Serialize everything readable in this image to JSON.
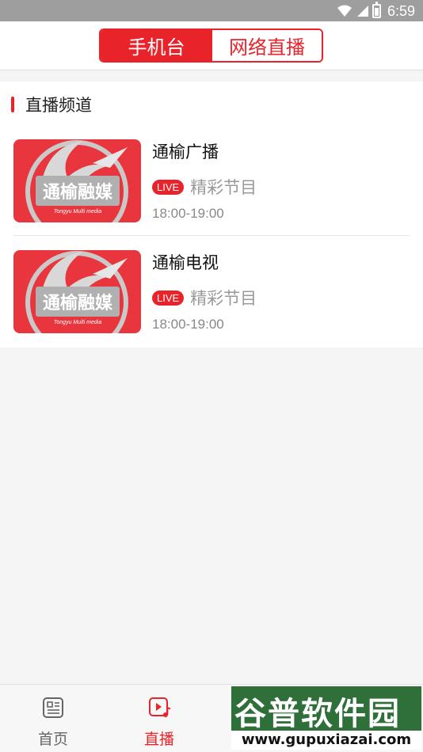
{
  "status_bar": {
    "time": "6:59"
  },
  "header": {
    "tabs": [
      {
        "label": "手机台",
        "active": true
      },
      {
        "label": "网络直播",
        "active": false
      }
    ]
  },
  "section": {
    "title": "直播频道",
    "channels": [
      {
        "name": "通榆广播",
        "badge": "LIVE",
        "program": "精彩节目",
        "time": "18:00-19:00",
        "thumb_text": "通榆融媒",
        "thumb_sub": "Tongyu Multi media"
      },
      {
        "name": "通榆电视",
        "badge": "LIVE",
        "program": "精彩节目",
        "time": "18:00-19:00",
        "thumb_text": "通榆融媒",
        "thumb_sub": "Tongyu Multi media"
      }
    ]
  },
  "bottom_nav": {
    "items": [
      {
        "label": "首页",
        "icon": "news-icon",
        "active": false
      },
      {
        "label": "直播",
        "icon": "live-play-icon",
        "active": true
      }
    ]
  },
  "watermark": {
    "title": "谷普软件园",
    "url": "www.gupuxiazai.com"
  },
  "colors": {
    "accent": "#e9232a",
    "status_bar": "#9e9e9e",
    "background": "#f5f5f5"
  }
}
